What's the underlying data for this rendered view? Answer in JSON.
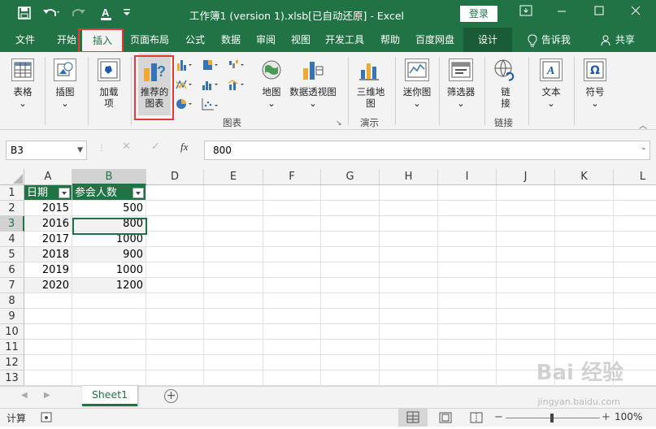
{
  "titlebar": {
    "title": "工作簿1 (version 1).xlsb[已自动还原]  -  Excel",
    "login": "登录",
    "save_icon": "save-icon",
    "undo_icon": "undo-icon",
    "redo_icon": "redo-icon",
    "font_color_icon": "font-color-icon",
    "customize_icon": "customize-icon"
  },
  "tabs": [
    "文件",
    "开始",
    "插入",
    "页面布局",
    "公式",
    "数据",
    "审阅",
    "视图",
    "开发工具",
    "帮助",
    "百度网盘",
    "设计"
  ],
  "tell_me": "告诉我",
  "share": "共享",
  "ribbon": {
    "table": "表格",
    "illustrations": "插图",
    "addins_1": "加载",
    "addins_2": "项",
    "recommended_1": "推荐的",
    "recommended_2": "图表",
    "charts_group": "图表",
    "map": "地图",
    "pivotchart": "数据透视图",
    "map3d_1": "三维地",
    "map3d_2": "图",
    "tours_group": "演示",
    "sparklines": "迷你图",
    "filters": "筛选器",
    "link_1": "链",
    "link_2": "接",
    "links_group": "链接",
    "text": "文本",
    "symbols": "符号"
  },
  "formula_bar": {
    "name_box": "B3",
    "fx": "fx",
    "value": "800"
  },
  "columns": [
    "A",
    "B",
    "D",
    "E",
    "F",
    "G",
    "H",
    "I",
    "J",
    "K",
    "L"
  ],
  "rows": [
    "1",
    "2",
    "3",
    "4",
    "5",
    "6",
    "7",
    "8",
    "9",
    "10",
    "11",
    "12",
    "13"
  ],
  "table": {
    "headers": [
      "日期",
      "参会人数"
    ],
    "data": [
      [
        "2015",
        "500"
      ],
      [
        "2016",
        "800"
      ],
      [
        "2017",
        "1000"
      ],
      [
        "2018",
        "900"
      ],
      [
        "2019",
        "1000"
      ],
      [
        "2020",
        "1200"
      ]
    ]
  },
  "sheet_tab": "Sheet1",
  "status": {
    "mode": "计算",
    "zoom": "100%"
  },
  "watermark": "Bai 经验",
  "watermark_url": "jingyan.baidu.com"
}
